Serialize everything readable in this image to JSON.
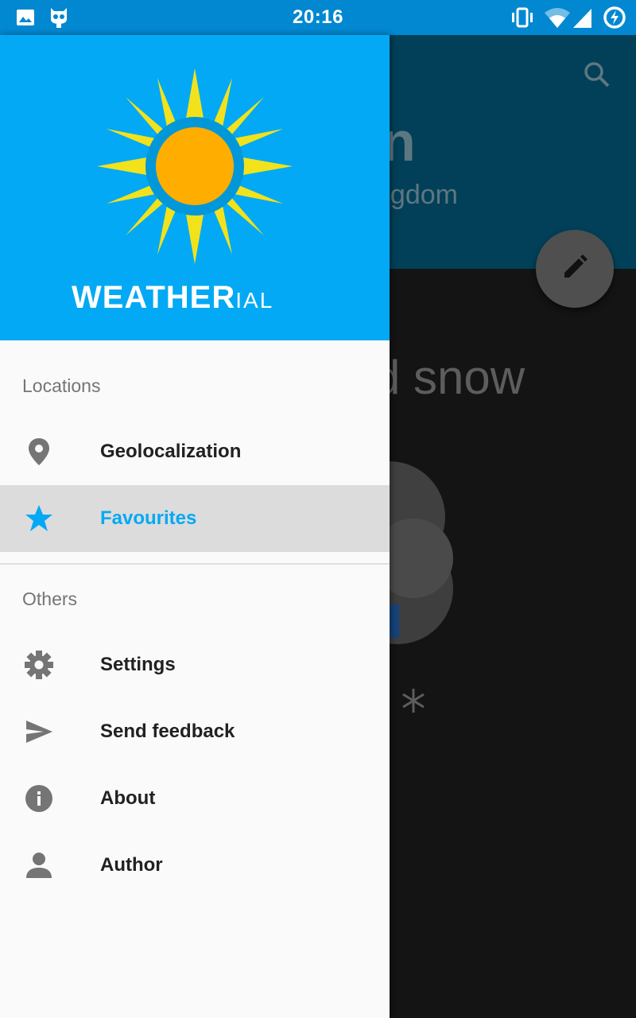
{
  "status_bar": {
    "time": "20:16",
    "left_icons": [
      "image-icon",
      "cyanogen-mascot-icon"
    ],
    "right_icons": [
      "vibrate-icon",
      "wifi-icon",
      "signal-icon",
      "battery-charging-icon"
    ]
  },
  "background_app": {
    "title_fragment": "n",
    "subtitle_fragment": "ngdom",
    "condition_fragment": "d snow",
    "icons": [
      "search-icon",
      "edit-icon",
      "cloud-icon",
      "snowflake-icon"
    ]
  },
  "drawer": {
    "logo": {
      "main": "WEATHER",
      "suffix": "IAL"
    },
    "sections": [
      {
        "label": "Locations",
        "items": [
          {
            "label": "Geolocalization",
            "icon": "location-pin-icon",
            "active": false
          },
          {
            "label": "Favourites",
            "icon": "star-icon",
            "active": true
          }
        ]
      },
      {
        "label": "Others",
        "items": [
          {
            "label": "Settings",
            "icon": "gear-icon",
            "active": false
          },
          {
            "label": "Send feedback",
            "icon": "send-icon",
            "active": false
          },
          {
            "label": "About",
            "icon": "info-icon",
            "active": false
          },
          {
            "label": "Author",
            "icon": "person-icon",
            "active": false
          }
        ]
      }
    ]
  },
  "colors": {
    "status_bar": "#0288d1",
    "drawer_header": "#03a9f4",
    "accent": "#03a9f4",
    "sun_core": "#ffae00",
    "sun_rays": "#f2e21b",
    "active_row": "#dcdcdc"
  }
}
